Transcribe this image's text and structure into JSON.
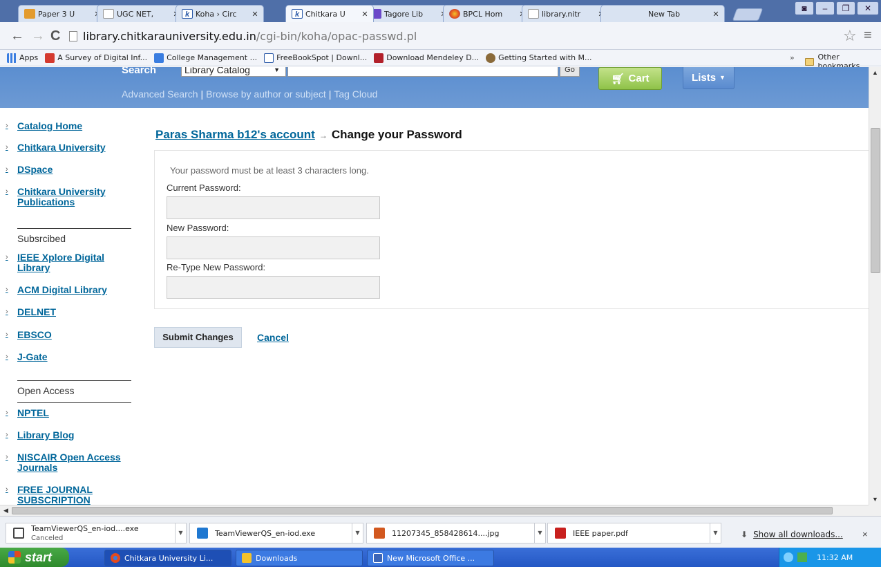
{
  "browser": {
    "tabs": [
      {
        "label": "Paper 3 U",
        "color": "#e39b2e"
      },
      {
        "label": "UGC NET,",
        "color": "#ffffff"
      },
      {
        "label": "Koha › Circ",
        "color": "#2a59a8",
        "glyph": "k"
      },
      {
        "label": "Chitkara U",
        "color": "#2a59a8",
        "glyph": "k",
        "active": true
      },
      {
        "label": "Tagore Lib",
        "color": "#6b49c9"
      },
      {
        "label": "BPCL Hom",
        "color": "#e24a1f"
      },
      {
        "label": "library.nitr",
        "color": "#ffffff"
      },
      {
        "label": "New Tab",
        "color": ""
      }
    ],
    "url_host": "library.chitkarauniversity.edu.in",
    "url_path": "/cgi-bin/koha/opac-passwd.pl",
    "bookmarks": [
      {
        "label": "Apps",
        "color": "#3a7de0"
      },
      {
        "label": "A Survey of Digital Inf...",
        "color": "#d43a2f"
      },
      {
        "label": "College Management ...",
        "color": "#3a7de0"
      },
      {
        "label": "FreeBookSpot | Downl...",
        "color": "#2a59a8"
      },
      {
        "label": "Download Mendeley D...",
        "color": "#b2202a"
      },
      {
        "label": "Getting Started with M...",
        "color": "#8a6a3a"
      }
    ],
    "bookmarks_overflow": "»",
    "other_bookmarks": "Other bookmarks"
  },
  "header": {
    "search_label": "Search",
    "catalog_select": "Library Catalog",
    "go_label": "Go",
    "cart_label": "Cart",
    "lists_label": "Lists",
    "subnav": [
      "Advanced Search",
      "Browse by author or subject",
      "Tag Cloud"
    ]
  },
  "sidebar": {
    "links_top": [
      "Catalog Home",
      "Chitkara University",
      "DSpace",
      "Chitkara University Publications"
    ],
    "heading_subscribed": "Subsrcibed",
    "links_subscribed": [
      "IEEE Xplore Digital Library",
      "ACM Digital Library",
      "DELNET",
      "EBSCO",
      "J-Gate"
    ],
    "heading_open": "Open Access",
    "links_open": [
      "NPTEL",
      "Library Blog",
      "NISCAIR Open Access Journals",
      "FREE JOURNAL SUBSCRIPTION"
    ]
  },
  "main": {
    "breadcrumb_link": "Paras Sharma b12's account",
    "breadcrumb_arrow": "→",
    "breadcrumb_current": "Change your Password",
    "hint": "Your password must be at least 3 characters long.",
    "current_label": "Current Password:",
    "new_label": "New Password:",
    "retype_label": "Re-Type New Password:",
    "submit_label": "Submit Changes",
    "cancel_label": "Cancel"
  },
  "downloads": {
    "items": [
      {
        "name": "TeamViewerQS_en-iod....exe",
        "status": "Canceled",
        "color": "#444444"
      },
      {
        "name": "TeamViewerQS_en-iod.exe",
        "status": "",
        "color": "#1f78d1"
      },
      {
        "name": "11207345_858428614....jpg",
        "status": "",
        "color": "#d2581f"
      },
      {
        "name": "IEEE paper.pdf",
        "status": "",
        "color": "#c8201e"
      }
    ],
    "show_all": "Show all downloads...",
    "close": "×"
  },
  "taskbar": {
    "start_label": "start",
    "items": [
      {
        "label": "Chitkara University Li...",
        "color": "#e24a1f"
      },
      {
        "label": "Downloads",
        "color": "#f3c22b"
      },
      {
        "label": "New Microsoft Office ...",
        "color": "#3c66b8"
      }
    ],
    "clock": "11:32 AM"
  }
}
